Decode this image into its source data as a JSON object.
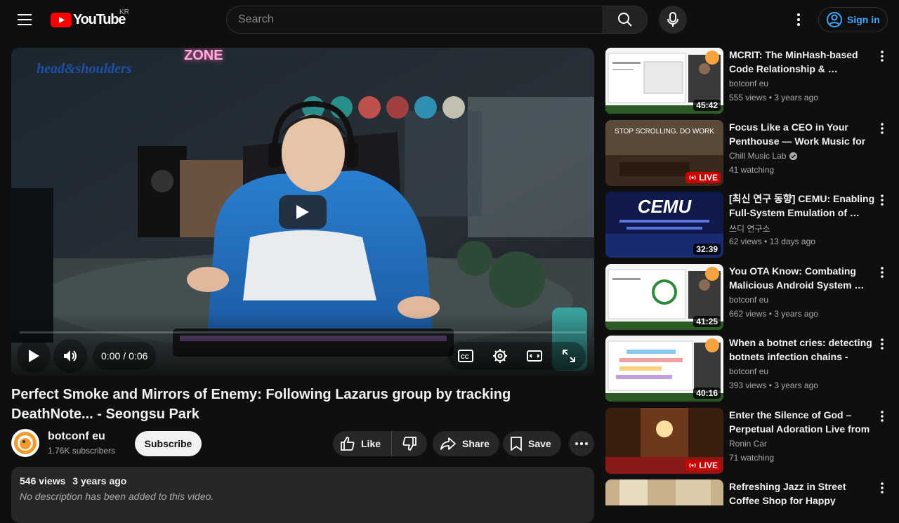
{
  "header": {
    "logo_text": "YouTube",
    "country": "KR",
    "search_placeholder": "Search",
    "sign_in": "Sign in"
  },
  "player": {
    "current_time": "0:00",
    "separator": "/",
    "duration": "0:06",
    "progress": 0,
    "overlay_brand": "head&shoulders",
    "overlay_sign": "ZONE"
  },
  "video": {
    "title": "Perfect Smoke and Mirrors of Enemy: Following Lazarus group by tracking DeathNote... - Seongsu Park",
    "channel": "botconf eu",
    "subscribers": "1.76K subscribers",
    "subscribe": "Subscribe",
    "like": "Like",
    "share": "Share",
    "save": "Save",
    "views": "546 views",
    "age": "3 years ago",
    "description": "No description has been added to this video."
  },
  "recommendations": [
    {
      "title": "MCRIT: The MinHash-based Code Relationship & …",
      "channel": "botconf eu",
      "verified": false,
      "views": "555 views",
      "age": "3 years ago",
      "duration": "45:42",
      "live": false
    },
    {
      "title": "Focus Like a CEO in Your Penthouse — Work Music for …",
      "channel": "Chill Music Lab",
      "verified": true,
      "views": "41 watching",
      "age": "",
      "duration": "LIVE",
      "live": true,
      "thumb_text": "STOP SCROLLING. DO WORK"
    },
    {
      "title": "[최신 연구 동향] CEMU: Enabling Full-System Emulation of …",
      "channel": "쓰디 연구소",
      "verified": false,
      "views": "62 views",
      "age": "13 days ago",
      "duration": "32:39",
      "live": false,
      "thumb_text": "CEMU"
    },
    {
      "title": "You OTA Know: Combating Malicious Android System …",
      "channel": "botconf eu",
      "verified": false,
      "views": "662 views",
      "age": "3 years ago",
      "duration": "41:25",
      "live": false
    },
    {
      "title": "When a botnet cries: detecting botnets infection chains - Erw…",
      "channel": "botconf eu",
      "verified": false,
      "views": "393 views",
      "age": "3 years ago",
      "duration": "40:16",
      "live": false
    },
    {
      "title": "Enter the Silence of God – Perpetual Adoration Live from …",
      "channel": "Ronin Car",
      "verified": false,
      "views": "71 watching",
      "age": "",
      "duration": "LIVE",
      "live": true
    },
    {
      "title": "Refreshing Jazz in Street Coffee Shop for Happy Morning - Soft…",
      "channel": "",
      "verified": false,
      "views": "",
      "age": "",
      "duration": "",
      "live": false
    }
  ],
  "colors": {
    "accent": "#3ea6ff",
    "brand_red": "#ff0000",
    "live_red": "#cc0000"
  }
}
